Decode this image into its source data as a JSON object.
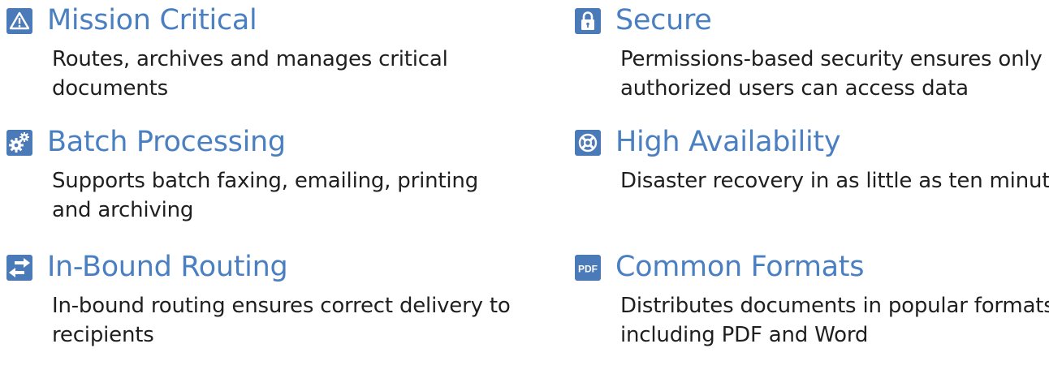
{
  "colors": {
    "accent": "#4a7fc1",
    "icon_background": "#4a7ab8",
    "body_text": "#1f1f1f"
  },
  "features": [
    {
      "icon": "warning-icon",
      "title": "Mission Critical",
      "description": "Routes, archives and manages critical documents"
    },
    {
      "icon": "gears-icon",
      "title": "Batch Processing",
      "description": "Supports batch faxing, emailing, printing and archiving"
    },
    {
      "icon": "swap-arrows-icon",
      "title": "In-Bound Routing",
      "description": "In-bound routing ensures correct delivery to recipients"
    },
    {
      "icon": "lock-icon",
      "title": "Secure",
      "description": "Permissions-based security ensures only authorized users can access data"
    },
    {
      "icon": "lifebuoy-icon",
      "title": "High Availability",
      "description": "Disaster recovery in as little as ten minutes"
    },
    {
      "icon": "pdf-icon",
      "icon_text": "PDF",
      "title": "Common Formats",
      "description": "Distributes documents in popular formats, including PDF and Word"
    }
  ]
}
